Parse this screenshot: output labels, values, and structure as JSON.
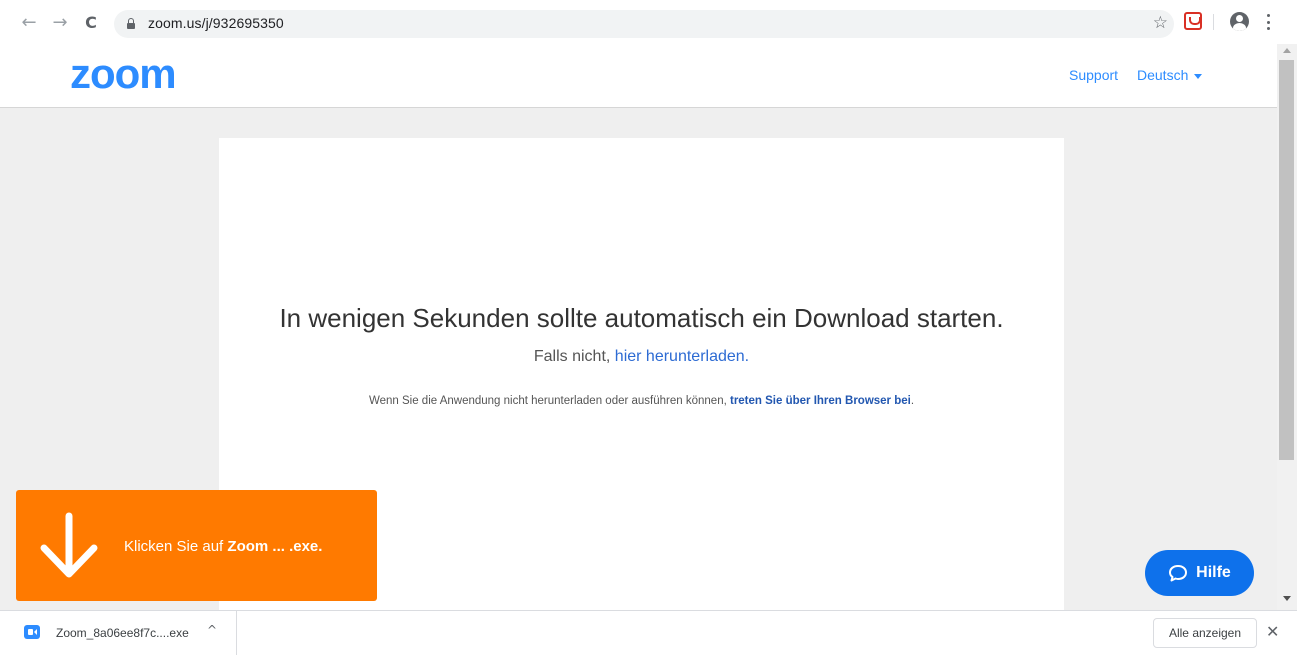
{
  "browser": {
    "url": "zoom.us/j/932695350",
    "back_icon": "←",
    "forward_icon": "→",
    "reload_icon": "C",
    "bookmark_icon": "☆"
  },
  "header": {
    "logo": "zoom",
    "support": "Support",
    "language": "Deutsch"
  },
  "main": {
    "heading": "In wenigen Sekunden sollte automatisch ein Download starten.",
    "fallback_prefix": "Falls nicht,",
    "fallback_link": "hier herunterladen",
    "fallback_suffix": ".",
    "browser_prefix": "Wenn Sie die Anwendung nicht herunterladen oder ausführen können,",
    "browser_link": "treten Sie über Ihren Browser bei",
    "browser_suffix": "."
  },
  "banner": {
    "text_prefix": "Klicken Sie auf",
    "text_bold": "Zoom ... .exe."
  },
  "help": {
    "label": "Hilfe"
  },
  "download_bar": {
    "file_name": "Zoom_8a06ee8f7c....exe",
    "chevron": "^",
    "show_all": "Alle anzeigen",
    "close": "✕"
  },
  "colors": {
    "brand": "#2d8cff",
    "banner": "#ff7a00",
    "help_button": "#0e71eb"
  }
}
